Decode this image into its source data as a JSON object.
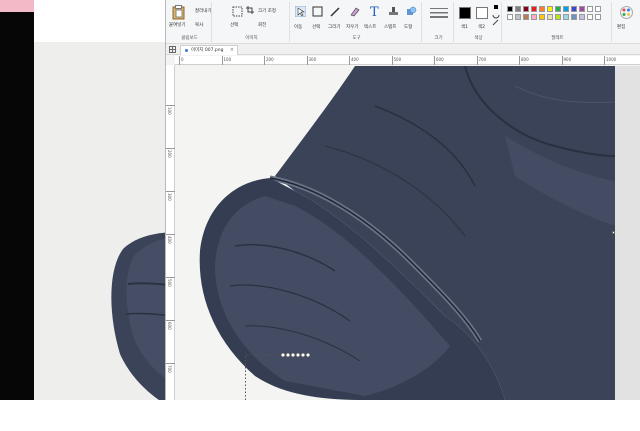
{
  "ribbon": {
    "clipboard": {
      "paste": "붙여넣기",
      "copy": "복사",
      "cut": "잘라내기",
      "group_label": "클립보드"
    },
    "image": {
      "select": "선택",
      "crop": "자르기",
      "resize": "크기 조정",
      "rotate": "회전",
      "group_label": "이미지"
    },
    "tools": {
      "pointer": "이동",
      "rect_select": "선택",
      "pencil": "그리기",
      "eraser": "지우기",
      "text": "텍스트",
      "stamp": "스탬프",
      "shape": "도형",
      "group_label": "도구"
    },
    "size": {
      "group_label": "크기"
    },
    "colors": {
      "color1_label": "색1",
      "color2_label": "색2",
      "color_label": "색상",
      "palette_label": "팔레트",
      "edit_colors_label": "편집"
    },
    "palette_row1": [
      "#000000",
      "#7f7f7f",
      "#880015",
      "#ed1c24",
      "#ff7f27",
      "#fff200",
      "#22b14c",
      "#00a2e8",
      "#3f48cc",
      "#a349a4"
    ],
    "palette_row2": [
      "#ffffff",
      "#c3c3c3",
      "#b97a57",
      "#ffaec9",
      "#ffc90e",
      "#efe4b0",
      "#b5e61d",
      "#99d9ea",
      "#7092be",
      "#c8bfe7"
    ],
    "color1": "#000000",
    "color2": "#ffffff"
  },
  "tab": {
    "filename": "이미지 007.png",
    "close": "×"
  },
  "ruler": {
    "h_ticks": [
      "0",
      "100",
      "200",
      "300",
      "400",
      "500",
      "600",
      "700",
      "800",
      "900",
      "1000"
    ],
    "v_ticks": [
      "100",
      "200",
      "300",
      "400",
      "500",
      "600",
      "700"
    ]
  },
  "colors": {
    "glove": "#3b4358",
    "glove_dark": "#252b3a",
    "glove_light": "#5a6379",
    "background": "#f4f4f2",
    "strip": "#060606",
    "pink": "#f4b9c6"
  }
}
